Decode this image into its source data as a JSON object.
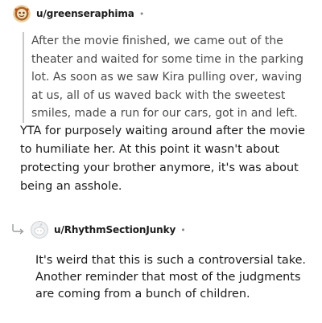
{
  "comments": [
    {
      "username": "u/greenseraphima",
      "separator": "•",
      "quote": "After the movie finished, we came out of the theater and waited for some time in the parking lot. As soon as we saw Kira pulling over, waving at us, all of us waved back with the sweetest smiles, made a run for our cars, got in and left.",
      "body": "YTA for purposely waiting around after the movie to humiliate her. At this point it wasn't about protecting your brother anymore, it's was about being an asshole."
    },
    {
      "username": "u/RhythmSectionJunky",
      "separator": "•",
      "body": "It's weird that this is such a controversial take. Another reminder that most of the judgments are coming from a bunch of children."
    }
  ],
  "icons": {
    "avatar_1": "snoo-avatar-icon",
    "avatar_2": "default-avatar-icon",
    "reply": "reply-arrow-icon"
  },
  "colors": {
    "quote_bar": "#c8c8c8",
    "quote_text": "#4a4a4a",
    "meta": "#878a8c"
  }
}
